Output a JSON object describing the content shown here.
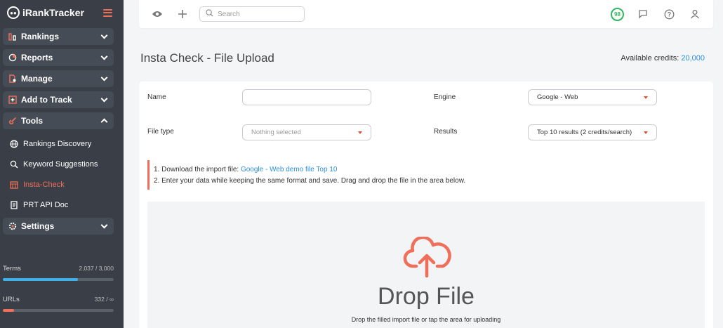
{
  "brand": {
    "name_prefix": "i",
    "name_dim": "",
    "name": "RankTracker"
  },
  "sidebar": {
    "groups": [
      {
        "label": "Rankings"
      },
      {
        "label": "Reports"
      },
      {
        "label": "Manage"
      },
      {
        "label": "Add to Track"
      },
      {
        "label": "Tools"
      }
    ],
    "tools_items": [
      {
        "label": "Rankings Discovery"
      },
      {
        "label": "Keyword Suggestions"
      },
      {
        "label": "Insta-Check"
      },
      {
        "label": "PRT API Doc"
      }
    ],
    "settings": {
      "label": "Settings"
    },
    "usage": {
      "terms": {
        "label": "Terms",
        "value": "2,037 / 3,000",
        "fraction": 0.679
      },
      "urls": {
        "label": "URLs",
        "value": "332 / ∞",
        "fraction": 0.1
      }
    }
  },
  "topbar": {
    "search_placeholder": "Search",
    "score": "98"
  },
  "page": {
    "title": "Insta Check - File Upload",
    "credits_label": "Available credits:",
    "credits_value": "20,000"
  },
  "form": {
    "name_label": "Name",
    "name_value": "",
    "file_type_label": "File type",
    "file_type_value": "Nothing selected",
    "engine_label": "Engine",
    "engine_value": "Google - Web",
    "results_label": "Results",
    "results_value": "Top 10 results (2 credits/search)"
  },
  "instructions": {
    "line1_prefix": "1. Download the import file: ",
    "line1_link": "Google - Web demo file Top 10",
    "line2": "2. Enter your data while keeping the same format and save. Drag and drop the file in the area below."
  },
  "dropzone": {
    "title": "Drop File",
    "subtitle": "Drop the filled import file or tap the area for uploading"
  },
  "colors": {
    "accent": "#ef6f5a",
    "link": "#2a8fd6",
    "sidebar_bg": "#3a3f47",
    "score_green": "#2eb85c",
    "terms_bar": "#3fb0e8",
    "urls_bar": "#ef6f5a"
  }
}
